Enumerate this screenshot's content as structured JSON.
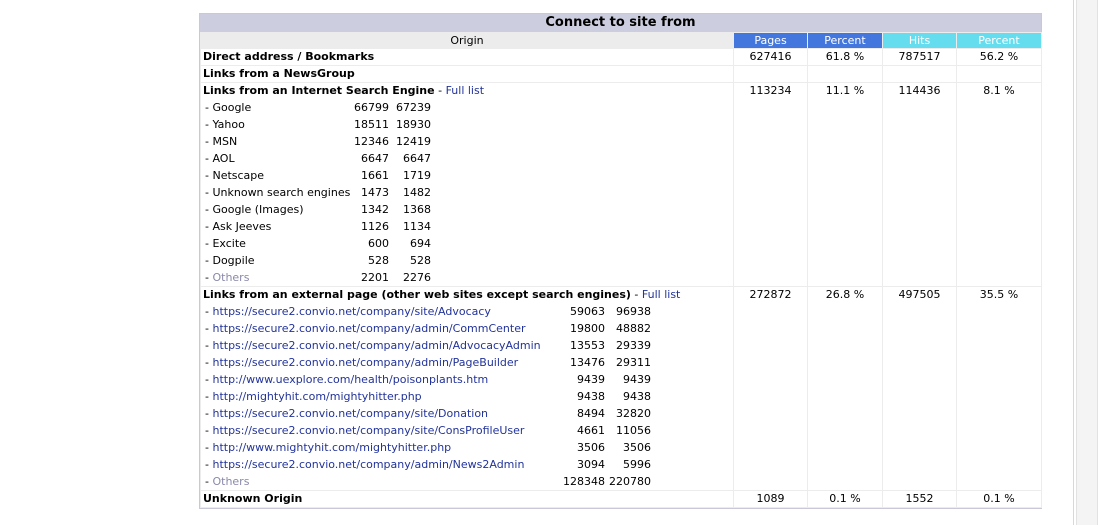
{
  "title": "Connect to site from",
  "headers": {
    "origin": "Origin",
    "pages": "Pages",
    "percent1": "Percent",
    "hits": "Hits",
    "percent2": "Percent"
  },
  "rows": {
    "direct": {
      "label": "Direct address / Bookmarks",
      "pages": "627416",
      "pct1": "61.8 %",
      "hits": "787517",
      "pct2": "56.2 %"
    },
    "newsgroup": {
      "label": "Links from a NewsGroup",
      "pages": "",
      "pct1": "",
      "hits": "",
      "pct2": ""
    },
    "search": {
      "label": "Links from an Internet Search Engine",
      "full_list": "Full list",
      "pages": "113234",
      "pct1": "11.1 %",
      "hits": "114436",
      "pct2": "8.1 %",
      "items": [
        {
          "name": "Google",
          "v1": "66799",
          "v2": "67239"
        },
        {
          "name": "Yahoo",
          "v1": "18511",
          "v2": "18930"
        },
        {
          "name": "MSN",
          "v1": "12346",
          "v2": "12419"
        },
        {
          "name": "AOL",
          "v1": "6647",
          "v2": "6647"
        },
        {
          "name": "Netscape",
          "v1": "1661",
          "v2": "1719"
        },
        {
          "name": "Unknown search engines",
          "v1": "1473",
          "v2": "1482"
        },
        {
          "name": "Google (Images)",
          "v1": "1342",
          "v2": "1368"
        },
        {
          "name": "Ask Jeeves",
          "v1": "1126",
          "v2": "1134"
        },
        {
          "name": "Excite",
          "v1": "600",
          "v2": "694"
        },
        {
          "name": "Dogpile",
          "v1": "528",
          "v2": "528"
        },
        {
          "name": "Others",
          "v1": "2201",
          "v2": "2276"
        }
      ]
    },
    "external": {
      "label": "Links from an external page (other web sites except search engines)",
      "full_list": "Full list",
      "pages": "272872",
      "pct1": "26.8 %",
      "hits": "497505",
      "pct2": "35.5 %",
      "items": [
        {
          "name": "https://secure2.convio.net/company/site/Advocacy",
          "v1": "59063",
          "v2": "96938"
        },
        {
          "name": "https://secure2.convio.net/company/admin/CommCenter",
          "v1": "19800",
          "v2": "48882"
        },
        {
          "name": "https://secure2.convio.net/company/admin/AdvocacyAdmin",
          "v1": "13553",
          "v2": "29339"
        },
        {
          "name": "https://secure2.convio.net/company/admin/PageBuilder",
          "v1": "13476",
          "v2": "29311"
        },
        {
          "name": "http://www.uexplore.com/health/poisonplants.htm",
          "v1": "9439",
          "v2": "9439"
        },
        {
          "name": "http://mightyhit.com/mightyhitter.php",
          "v1": "9438",
          "v2": "9438"
        },
        {
          "name": "https://secure2.convio.net/company/site/Donation",
          "v1": "8494",
          "v2": "32820"
        },
        {
          "name": "https://secure2.convio.net/company/site/ConsProfileUser",
          "v1": "4661",
          "v2": "11056"
        },
        {
          "name": "http://www.mightyhit.com/mightyhitter.php",
          "v1": "3506",
          "v2": "3506"
        },
        {
          "name": "https://secure2.convio.net/company/admin/News2Admin",
          "v1": "3094",
          "v2": "5996"
        },
        {
          "name": "Others",
          "v1": "128348",
          "v2": "220780"
        }
      ]
    },
    "unknown": {
      "label": "Unknown Origin",
      "pages": "1089",
      "pct1": "0.1 %",
      "hits": "1552",
      "pct2": "0.1 %"
    }
  },
  "colors": {
    "title_bg": "#cccdde",
    "pages_header": "#4477dd",
    "hits_header": "#66ddee",
    "link": "#223399"
  }
}
